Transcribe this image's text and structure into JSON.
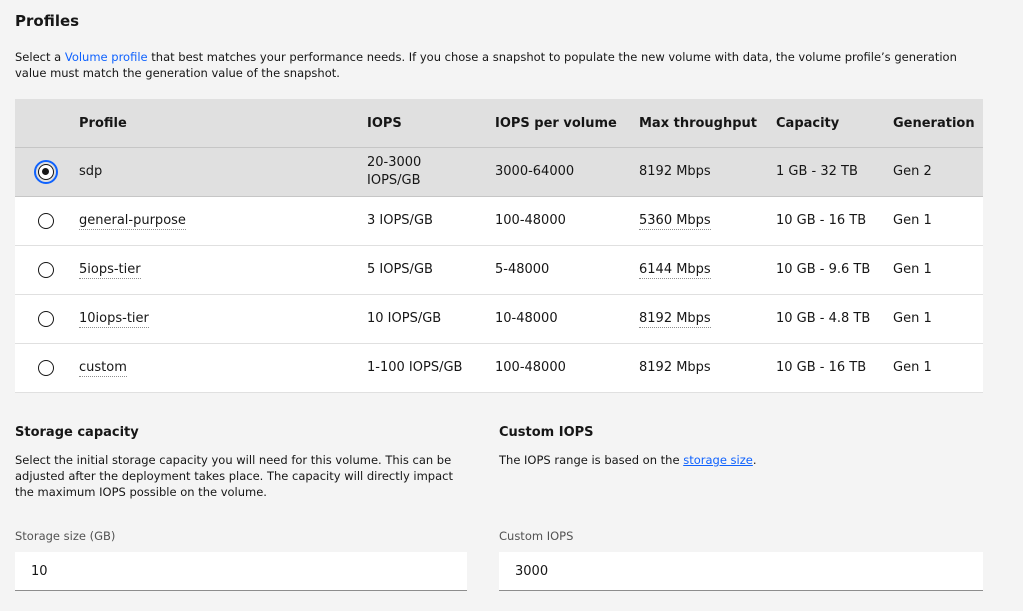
{
  "profiles": {
    "title": "Profiles",
    "intro_before": "Select a ",
    "intro_link": "Volume profile",
    "intro_after": " that best matches your performance needs. If you chose a snapshot to populate the new volume with data, the volume profile’s generation value must match the generation value of the snapshot.",
    "columns": [
      "Profile",
      "IOPS",
      "IOPS per volume",
      "Max throughput",
      "Capacity",
      "Generation"
    ],
    "rows": [
      {
        "name": "sdp",
        "iops": "20-3000 IOPS/GB",
        "iops_per_volume": "3000-64000",
        "max_throughput": "8192 Mbps",
        "capacity": "1 GB - 32 TB",
        "generation": "Gen 2",
        "selected": true
      },
      {
        "name": "general-purpose",
        "iops": "3 IOPS/GB",
        "iops_per_volume": "100-48000",
        "max_throughput": "5360 Mbps",
        "capacity": "10 GB - 16 TB",
        "generation": "Gen 1",
        "selected": false
      },
      {
        "name": "5iops-tier",
        "iops": "5 IOPS/GB",
        "iops_per_volume": "5-48000",
        "max_throughput": "6144 Mbps",
        "capacity": "10 GB - 9.6 TB",
        "generation": "Gen 1",
        "selected": false
      },
      {
        "name": "10iops-tier",
        "iops": "10 IOPS/GB",
        "iops_per_volume": "10-48000",
        "max_throughput": "8192 Mbps",
        "capacity": "10 GB - 4.8 TB",
        "generation": "Gen 1",
        "selected": false
      },
      {
        "name": "custom",
        "iops": "1-100 IOPS/GB",
        "iops_per_volume": "100-48000",
        "max_throughput": "8192 Mbps",
        "capacity": "10 GB - 16 TB",
        "generation": "Gen 1",
        "selected": false
      }
    ]
  },
  "storage": {
    "title": "Storage capacity",
    "description": "Select the initial storage capacity you will need for this volume. This can be adjusted after the deployment takes place. The capacity will directly impact the maximum IOPS possible on the volume.",
    "field_label": "Storage size (GB)",
    "value": "10"
  },
  "custom_iops": {
    "title": "Custom IOPS",
    "description_before": "The IOPS range is based on the ",
    "description_link": "storage size",
    "description_after": ".",
    "field_label": "Custom IOPS",
    "value": "3000"
  },
  "colors": {
    "background": "#f4f4f4",
    "link": "#0f62fe",
    "selected_row": "#e0e0e0",
    "header_row": "#e0e0e0"
  }
}
